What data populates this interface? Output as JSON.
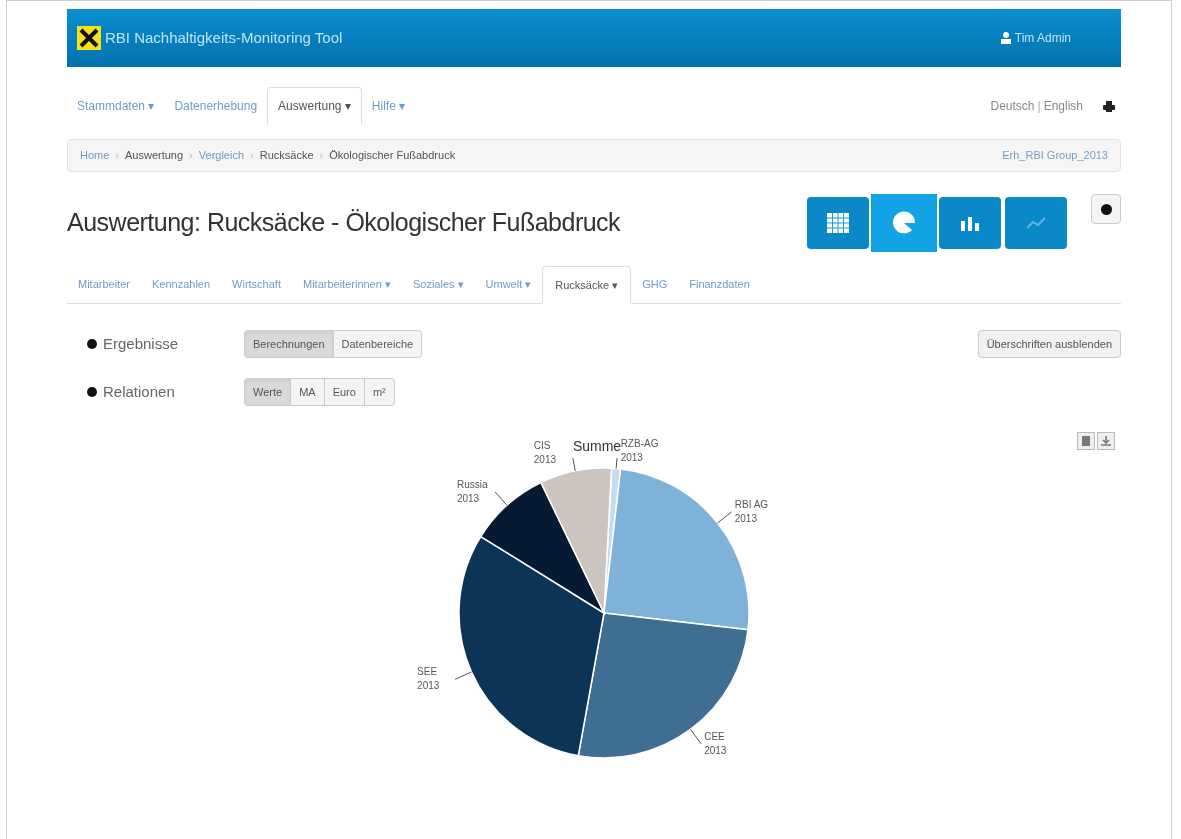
{
  "header": {
    "app_title": "RBI Nachhaltigkeits-Monitoring Tool",
    "user": "Tim Admin"
  },
  "nav": [
    {
      "label": "Stammdaten ▾",
      "selected": false
    },
    {
      "label": "Datenerhebung",
      "selected": false
    },
    {
      "label": "Auswertung ▾",
      "selected": true
    },
    {
      "label": "Hilfe ▾",
      "selected": false
    }
  ],
  "languages": [
    "Deutsch",
    "English"
  ],
  "language_separator": "|",
  "breadcrumb_separator": "›",
  "breadcrumb": [
    {
      "label": "Home",
      "link": true
    },
    {
      "label": "Auswertung",
      "link": false
    },
    {
      "label": "Vergleich",
      "link": true
    },
    {
      "label": "Rucksäcke",
      "link": false
    },
    {
      "label": "Ökologischer Fußabdruck",
      "link": false
    }
  ],
  "dataset": "Erh_RBI Group_2013",
  "page_title": "Auswertung: Rucksäcke - Ökologischer Fußabdruck",
  "view_buttons": [
    {
      "kind": "table",
      "selected": false
    },
    {
      "kind": "pie",
      "selected": true
    },
    {
      "kind": "bar",
      "selected": false
    },
    {
      "kind": "line",
      "selected": false
    }
  ],
  "tabs": [
    {
      "label": "Mitarbeiter",
      "selected": false
    },
    {
      "label": "Kennzahlen",
      "selected": false
    },
    {
      "label": "Wirtschaft",
      "selected": false
    },
    {
      "label": "Mitarbeiterinnen ▾",
      "selected": false
    },
    {
      "label": "Soziales ▾",
      "selected": false
    },
    {
      "label": "Umwelt ▾",
      "selected": false
    },
    {
      "label": "Rucksäcke ▾",
      "selected": true
    },
    {
      "label": "GHG",
      "selected": false
    },
    {
      "label": "Finanzdaten",
      "selected": false
    }
  ],
  "options": [
    {
      "label": "Ergebnisse",
      "buttons": [
        {
          "label": "Berechnungen",
          "selected": true
        },
        {
          "label": "Datenbereiche",
          "selected": false
        }
      ]
    },
    {
      "label": "Relationen",
      "buttons": [
        {
          "label": "Werte",
          "selected": true
        },
        {
          "label": "MA",
          "selected": false
        },
        {
          "label": "Euro",
          "selected": false
        },
        {
          "label": "m²",
          "selected": false
        }
      ]
    }
  ],
  "hide_headings_button": "Überschriften ausblenden",
  "chart_data": {
    "type": "pie",
    "title": "Summe",
    "categories": [
      "RZB-AG 2013",
      "RBI AG 2013",
      "CEE 2013",
      "SEE 2013",
      "Russia 2013",
      "CIS 2013"
    ],
    "values": [
      1,
      25,
      26,
      31,
      9,
      8
    ],
    "colors": [
      "#c6dbef",
      "#7fb2d8",
      "#3f6e93",
      "#0c3457",
      "#061a33",
      "#cbc4bf"
    ]
  }
}
